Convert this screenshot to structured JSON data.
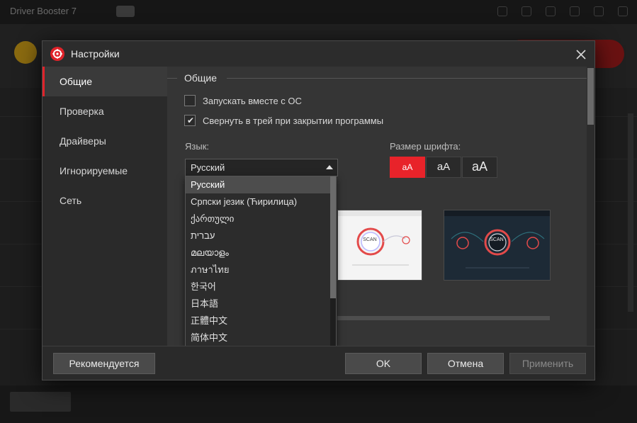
{
  "background_app": {
    "title": "Driver Booster 7"
  },
  "dialog": {
    "title": "Настройки",
    "sidebar": {
      "items": [
        {
          "label": "Общие",
          "active": true
        },
        {
          "label": "Проверка",
          "active": false
        },
        {
          "label": "Драйверы",
          "active": false
        },
        {
          "label": "Игнорируемые",
          "active": false
        },
        {
          "label": "Сеть",
          "active": false
        }
      ]
    },
    "general": {
      "section_title": "Общие",
      "options": [
        {
          "label": "Запускать вместе с ОС",
          "checked": false
        },
        {
          "label": "Свернуть в трей при закрытии программы",
          "checked": true
        }
      ],
      "language_label": "Язык:",
      "language_value": "Русский",
      "font_size_label": "Размер шрифта:",
      "font_sizes": [
        {
          "label": "aA",
          "active": true
        },
        {
          "label": "aA",
          "active": false
        },
        {
          "label": "aA",
          "active": false
        }
      ],
      "theme_scan_label": "SCAN"
    },
    "language_dropdown": {
      "options": [
        "Русский",
        "Српски језик (Ћирилица)",
        "ქართული",
        "עברית",
        "മലയാളം",
        "ภาษาไทย",
        "한국어",
        "日本語",
        "正體中文",
        "简体中文"
      ],
      "selected": "Русский"
    },
    "footer": {
      "recommended_label": "Рекомендуется",
      "ok_label": "OK",
      "cancel_label": "Отмена",
      "apply_label": "Применить"
    }
  },
  "colors": {
    "accent": "#e8232a",
    "dialog_bg": "#353535",
    "sidebar_bg": "#2a2a2a"
  }
}
